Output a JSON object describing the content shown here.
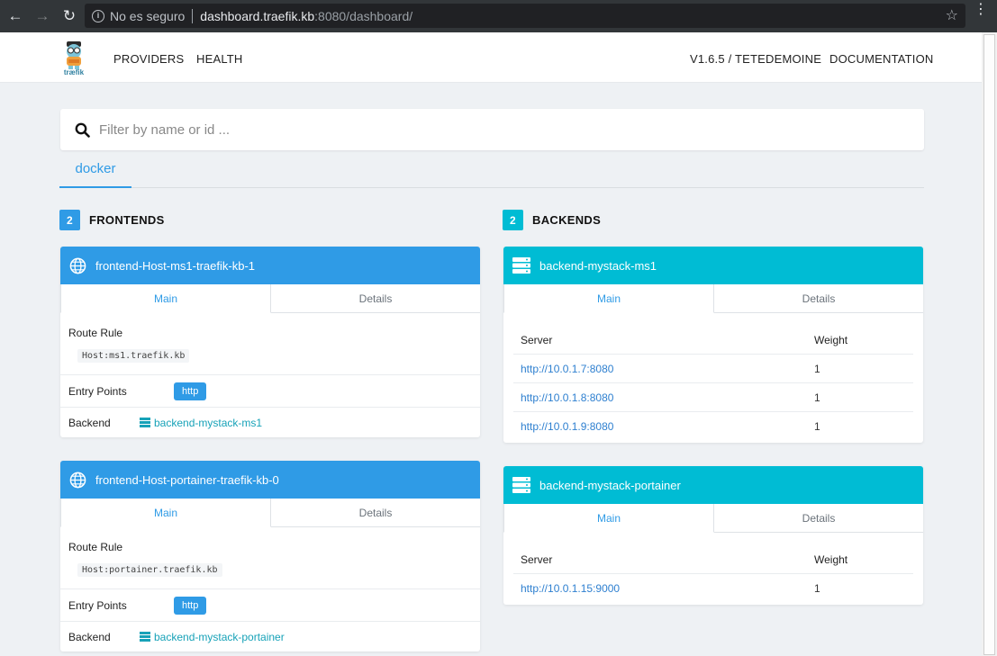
{
  "browser": {
    "security_text": "No es seguro",
    "url_host": "dashboard.traefik.kb",
    "url_rest": ":8080/dashboard/"
  },
  "header": {
    "logo_text": "træfik",
    "nav_providers": "PROVIDERS",
    "nav_health": "HEALTH",
    "version": "V1.6.5 / TETEDEMOINE",
    "documentation": "DOCUMENTATION"
  },
  "search": {
    "placeholder": "Filter by name or id ..."
  },
  "tabs": [
    {
      "label": "docker"
    }
  ],
  "colors": {
    "accent": "#2f9be6",
    "backend": "#00bcd4",
    "link": "#17a2b8"
  },
  "frontends": {
    "count": "2",
    "title": "FRONTENDS",
    "items": [
      {
        "name": "frontend-Host-ms1-traefik-kb-1",
        "tab_main": "Main",
        "tab_details": "Details",
        "route_rule_label": "Route Rule",
        "route_rule": "Host:ms1.traefik.kb",
        "entry_points_label": "Entry Points",
        "entry_point": "http",
        "backend_label": "Backend",
        "backend": "backend-mystack-ms1"
      },
      {
        "name": "frontend-Host-portainer-traefik-kb-0",
        "tab_main": "Main",
        "tab_details": "Details",
        "route_rule_label": "Route Rule",
        "route_rule": "Host:portainer.traefik.kb",
        "entry_points_label": "Entry Points",
        "entry_point": "http",
        "backend_label": "Backend",
        "backend": "backend-mystack-portainer"
      }
    ]
  },
  "backends": {
    "count": "2",
    "title": "BACKENDS",
    "server_col": "Server",
    "weight_col": "Weight",
    "items": [
      {
        "name": "backend-mystack-ms1",
        "tab_main": "Main",
        "tab_details": "Details",
        "servers": [
          {
            "url": "http://10.0.1.7:8080",
            "weight": "1"
          },
          {
            "url": "http://10.0.1.8:8080",
            "weight": "1"
          },
          {
            "url": "http://10.0.1.9:8080",
            "weight": "1"
          }
        ]
      },
      {
        "name": "backend-mystack-portainer",
        "tab_main": "Main",
        "tab_details": "Details",
        "servers": [
          {
            "url": "http://10.0.1.15:9000",
            "weight": "1"
          }
        ]
      }
    ]
  }
}
